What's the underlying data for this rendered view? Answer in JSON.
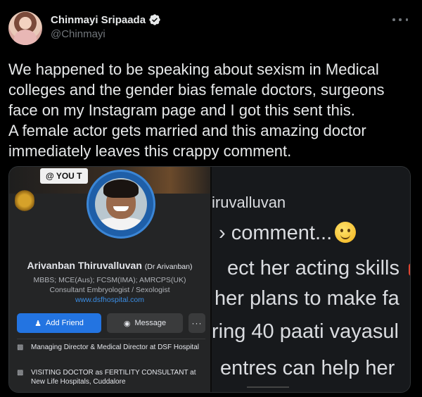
{
  "author": {
    "display_name": "Chinmayi Sripaada",
    "handle": "@Chinmayi",
    "verified": true
  },
  "tweet": {
    "text": "We happened to be speaking about sexism in Medical colleges and the gender bias female doctors, surgeons face on my Instagram page and I got this sent this.\nA female actor gets married and this amazing doctor immediately leaves this crappy comment."
  },
  "media": {
    "profile": {
      "tag": "@ YOU T",
      "name": "Arivanban Thiruvalluvan",
      "nickname": "(Dr Arivanban)",
      "degrees": "MBBS; MCE(Aus); FCSM(IMA); AMRCPS(UK)",
      "title": "Consultant Embryologist / Sexologist",
      "website": "www.dsfhospital.com",
      "add_friend_label": "Add Friend",
      "message_label": "Message",
      "more_label": "···",
      "info": [
        "Managing Director & Medical Director at DSF Hospital",
        "VISITING DOCTOR as FERTILITY CONSULTANT at New Life Hospitals, Cuddalore"
      ]
    },
    "zoom": {
      "line1": "iruvalluvan",
      "line2": "› comment...",
      "line3": "ect her acting skills",
      "line4": "her plans to make fa",
      "line5": "ring 40 paati vayasul",
      "line6": "entres can help her"
    }
  },
  "colors": {
    "background": "#000000",
    "text": "#e7e9ea",
    "muted": "#71767b",
    "verified": "#1d9bf0",
    "fb_blue": "#2374e1"
  }
}
